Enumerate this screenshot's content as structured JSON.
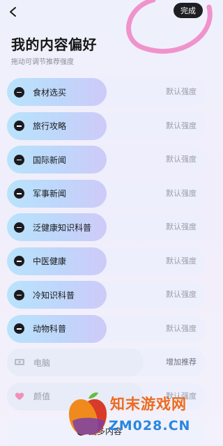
{
  "header": {
    "done_label": "完成",
    "title": "我的内容偏好",
    "subtitle": "拖动可调节推荐强度"
  },
  "preferences": [
    {
      "label": "食材选买",
      "status": "默认强度"
    },
    {
      "label": "旅行攻略",
      "status": "默认强度"
    },
    {
      "label": "国际新闻",
      "status": "默认强度"
    },
    {
      "label": "军事新闻",
      "status": "默认强度"
    },
    {
      "label": "泛健康知识科普",
      "status": "默认强度"
    },
    {
      "label": "中医健康",
      "status": "默认强度"
    },
    {
      "label": "冷知识科普",
      "status": "默认强度"
    },
    {
      "label": "动物科普",
      "status": "默认强度"
    }
  ],
  "inactive": [
    {
      "label": "电脑",
      "status": "增加推荐",
      "icon": "computer-icon"
    },
    {
      "label": "颜值",
      "status": "默认强度",
      "icon": "heart-icon"
    }
  ],
  "more_label": "更多内容",
  "watermark": {
    "line1": "知末游戏网",
    "line2": "ZM028.CN"
  },
  "colors": {
    "pill_start": "#b9e3fb",
    "pill_end": "#cfcaf8",
    "done_bg": "#1f1f22",
    "swirl": "#f07cc0"
  }
}
